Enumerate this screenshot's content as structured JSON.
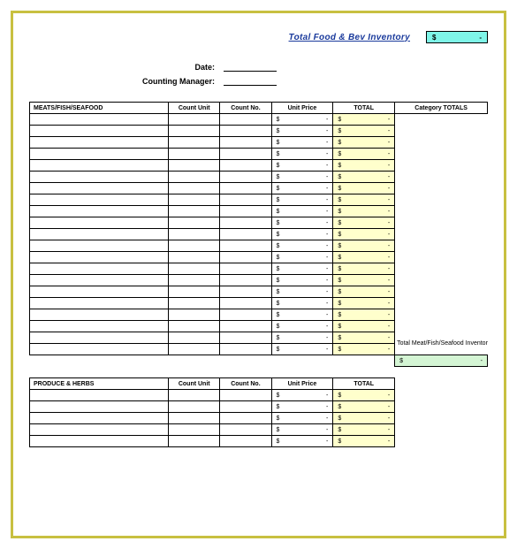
{
  "header": {
    "title": "Total Food & Bev Inventory",
    "grand_total_symbol": "$",
    "grand_total_value": "-"
  },
  "meta": {
    "date_label": "Date:",
    "counting_manager_label": "Counting Manager:"
  },
  "columns": {
    "count_unit": "Count Unit",
    "count_no": "Count No.",
    "unit_price": "Unit Price",
    "total": "TOTAL",
    "category_totals": "Category TOTALS"
  },
  "sections": {
    "meats": {
      "title": "MEATS/FISH/SEAFOOD",
      "rows": 21,
      "category_label": "Total Meat/Fish/Seafood Inventory",
      "subtotal_symbol": "$",
      "subtotal_value": "-"
    },
    "produce": {
      "title": "PRODUCE & HERBS",
      "rows": 5
    }
  },
  "money": {
    "symbol": "$",
    "dash": "-"
  }
}
